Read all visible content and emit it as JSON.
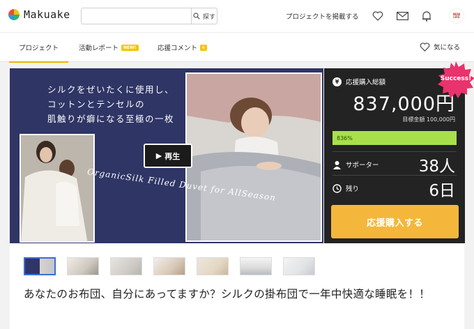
{
  "header": {
    "logo_text": "Makuake",
    "search_placeholder": "",
    "search_button": "探す",
    "post_project_link": "プロジェクトを掲載する",
    "avatar_text": "NEW LIFE"
  },
  "tabs": [
    {
      "label": "プロジェクト",
      "active": true
    },
    {
      "label": "活動レポート",
      "badge": "NEW!"
    },
    {
      "label": "応援コメント",
      "badge": "6"
    }
  ],
  "favorite_label": "気になる",
  "hero": {
    "copy_lines": [
      "シルクをぜいたくに使用し、",
      "コットンとテンセルの",
      "肌触りが癖になる至極の一枚"
    ],
    "script_text": "OrganicSilk Filled Duvet for AllSeason",
    "play_label": "再生"
  },
  "stats": {
    "total_label": "応援購入総額",
    "total_value": "837,000円",
    "goal_text": "目標金額 100,000円",
    "progress_percent": 836,
    "progress_label": "836%",
    "supporters_label": "サポーター",
    "supporters_value": "38人",
    "remaining_label": "残り",
    "remaining_value": "6日",
    "buy_button": "応援購入する",
    "success_badge": "Success!"
  },
  "thumbnails": [
    "thumb-1",
    "thumb-2",
    "thumb-3",
    "thumb-4",
    "thumb-5",
    "thumb-6",
    "thumb-7"
  ],
  "project_title": "あなたのお布団、自分にあってますか？シルクの掛布団で一年中快適な睡眠を！！",
  "colors": {
    "accent": "#f4b73c",
    "panel_bg": "#232323",
    "hero_bg": "#2f3565",
    "progress": "#a8e04b",
    "success_badge": "#e8336d"
  }
}
